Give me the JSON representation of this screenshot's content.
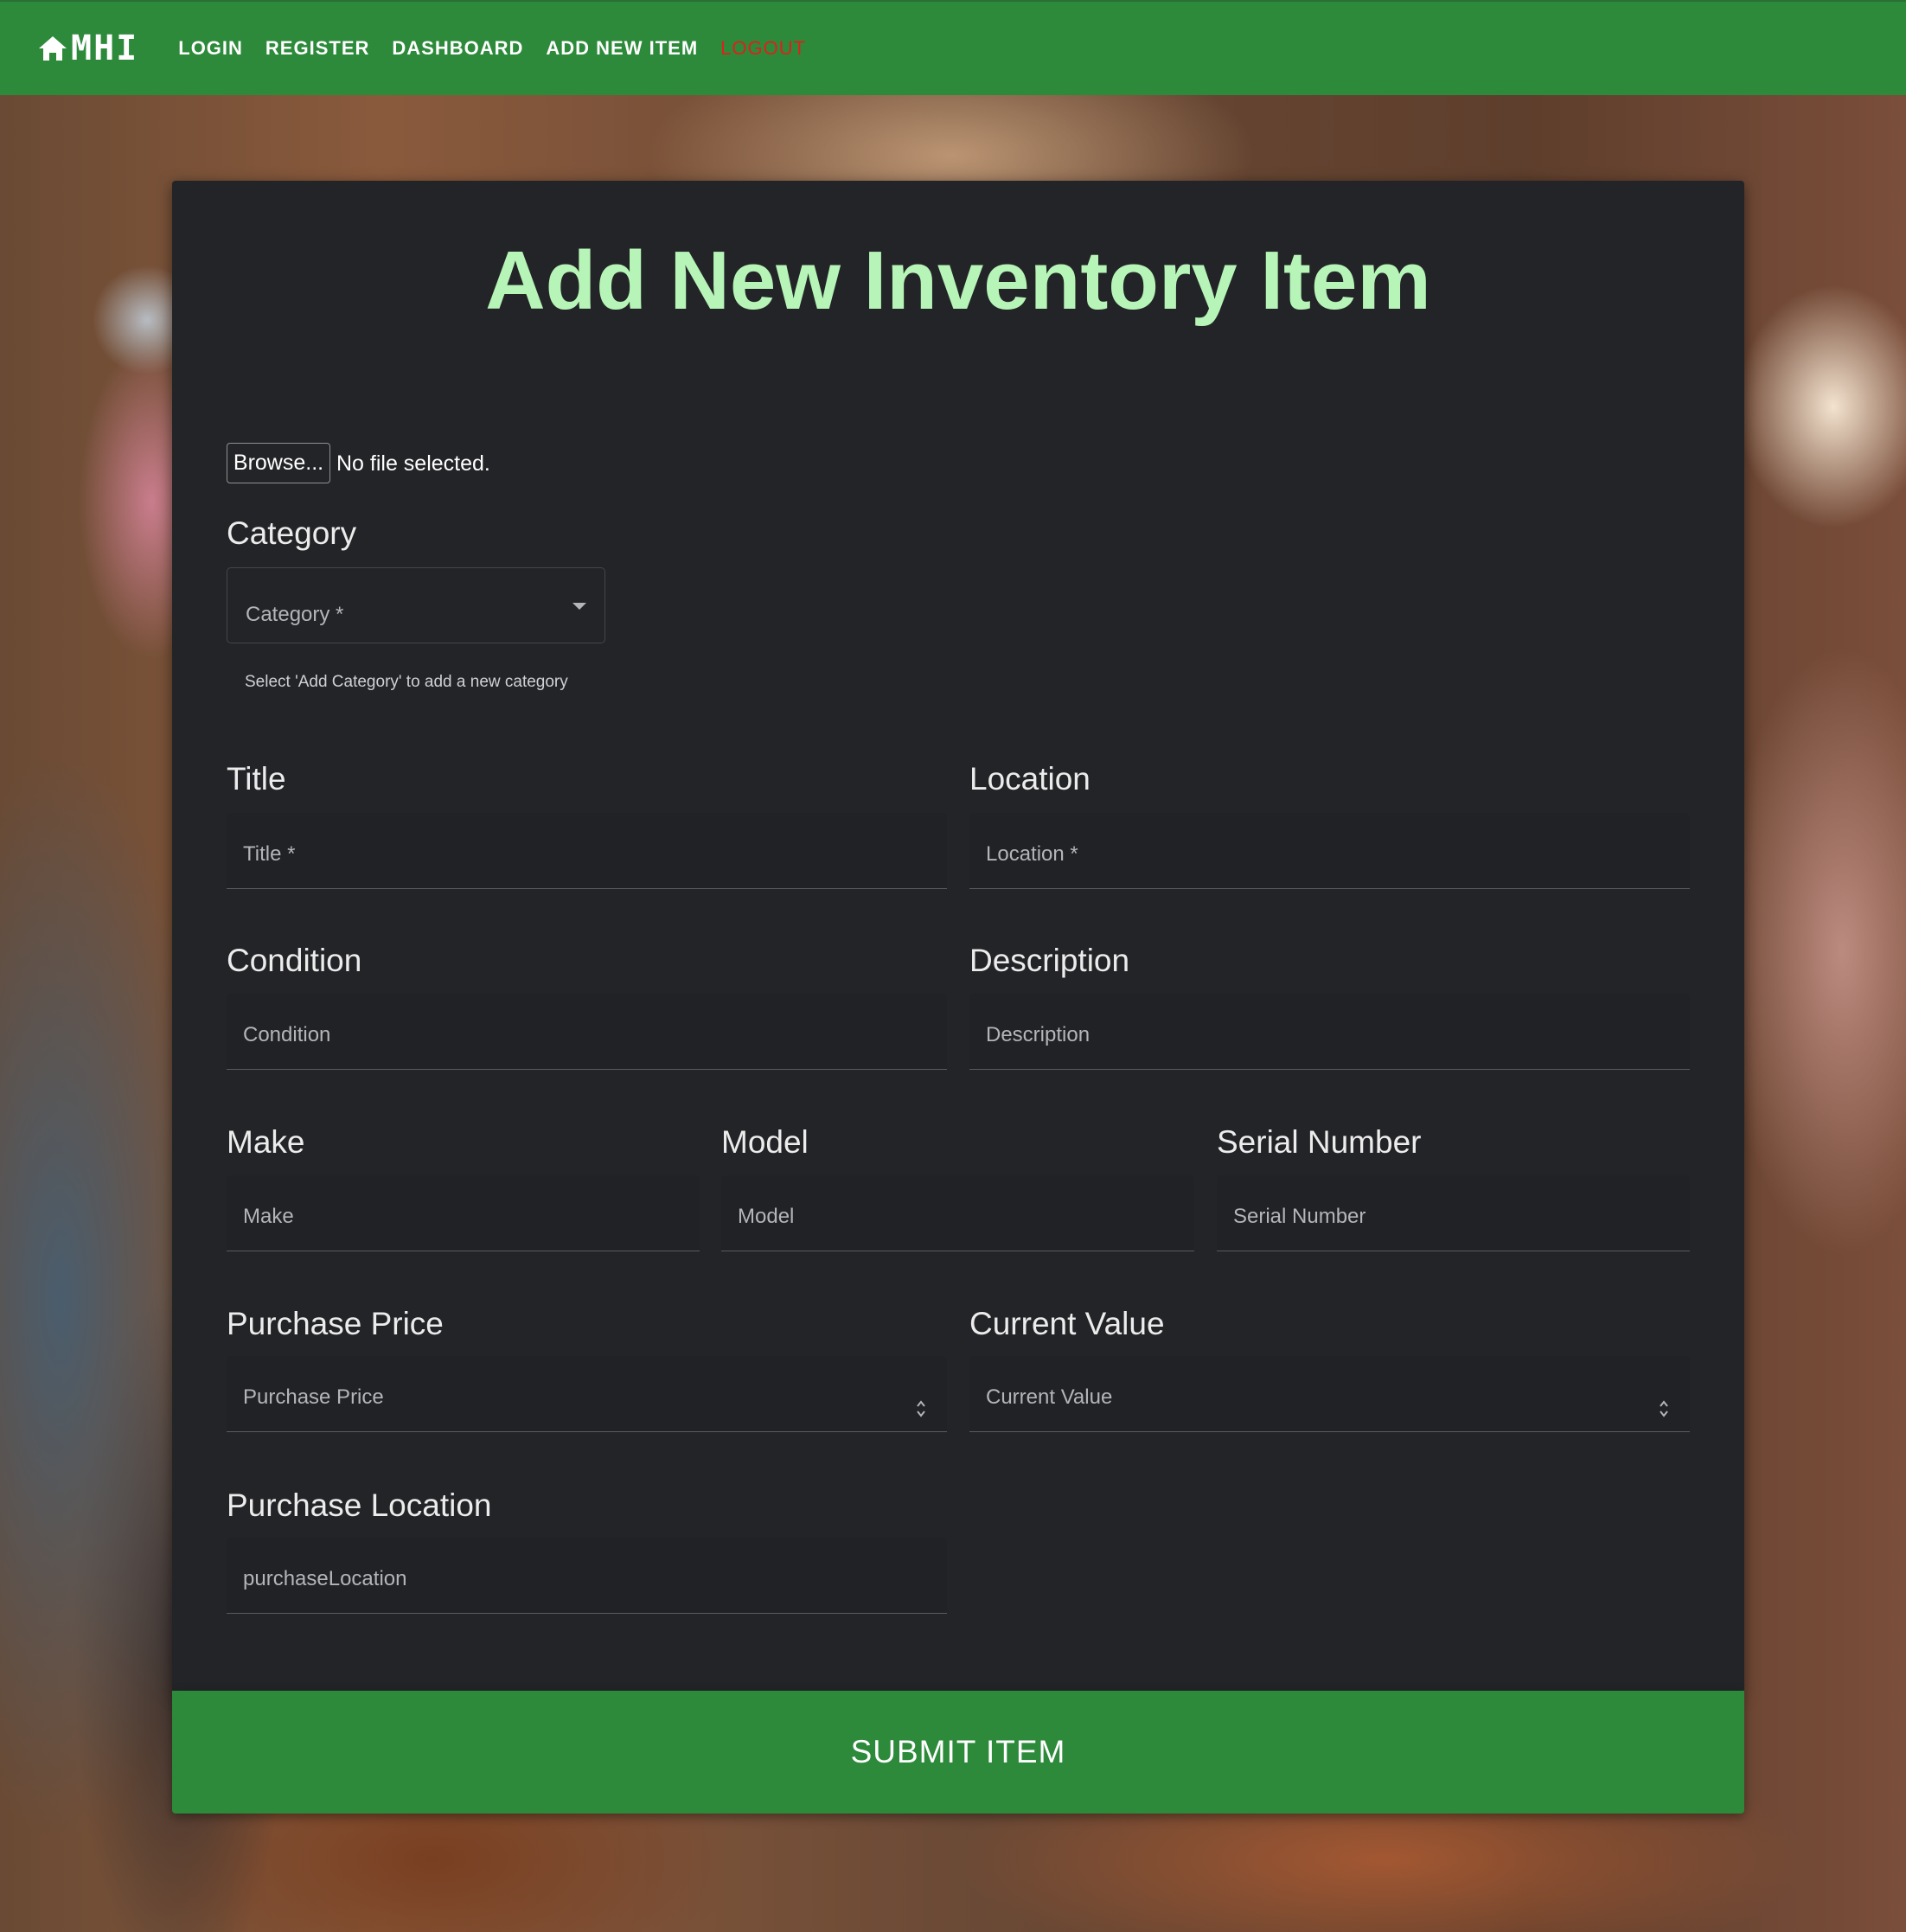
{
  "nav": {
    "brand": "MHI",
    "links": [
      "LOGIN",
      "REGISTER",
      "DASHBOARD",
      "ADD NEW ITEM",
      "LOGOUT"
    ],
    "logout_color": "#e0201a"
  },
  "form": {
    "title": "Add New Inventory Item",
    "file": {
      "button": "Browse...",
      "status": "No file selected."
    },
    "category": {
      "label": "Category",
      "placeholder": "Category *",
      "helper": "Select 'Add Category' to add a new category"
    },
    "title_field": {
      "label": "Title",
      "placeholder": "Title *"
    },
    "location": {
      "label": "Location",
      "placeholder": "Location *"
    },
    "condition": {
      "label": "Condition",
      "placeholder": "Condition"
    },
    "description": {
      "label": "Description",
      "placeholder": "Description"
    },
    "make": {
      "label": "Make",
      "placeholder": "Make"
    },
    "model": {
      "label": "Model",
      "placeholder": "Model"
    },
    "serial": {
      "label": "Serial Number",
      "placeholder": "Serial Number"
    },
    "purchase_price": {
      "label": "Purchase Price",
      "placeholder": "Purchase Price"
    },
    "current_value": {
      "label": "Current Value",
      "placeholder": "Current Value"
    },
    "purchase_location": {
      "label": "Purchase Location",
      "placeholder": "purchaseLocation"
    },
    "submit": "SUBMIT ITEM"
  },
  "colors": {
    "accent": "#2c8a3a",
    "title": "#b6f5b7",
    "card": "#232427"
  }
}
